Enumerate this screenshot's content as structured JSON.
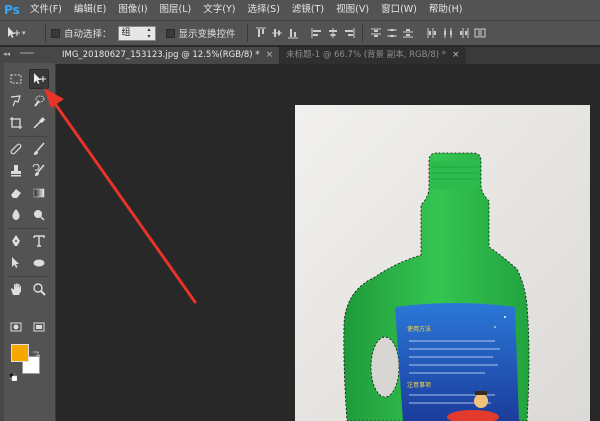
{
  "app": {
    "logo": "Ps"
  },
  "menu": [
    "文件(F)",
    "编辑(E)",
    "图像(I)",
    "图层(L)",
    "文字(Y)",
    "选择(S)",
    "滤镜(T)",
    "视图(V)",
    "窗口(W)",
    "帮助(H)"
  ],
  "options": {
    "auto_select_label": "自动选择：",
    "auto_select_value": "组",
    "show_transform_label": "显示变换控件"
  },
  "tabs": [
    {
      "label": "IMG_20180627_153123.jpg @ 12.5%(RGB/8) *",
      "close": "×",
      "active": true
    },
    {
      "label": "未标题-1 @ 66.7% (背景 副本, RGB/8) *",
      "close": "×",
      "active": false
    }
  ],
  "toolbox": {
    "collapse_glyph": "◂◂"
  },
  "colors": {
    "foreground": "#f5a800",
    "background": "#ffffff",
    "annotation_arrow": "#e8332b",
    "bottle_green": "#2fb84a",
    "label_blue": "#1f5cc7"
  },
  "product_label": {
    "title": "使用方法",
    "warning": "注意事项"
  }
}
